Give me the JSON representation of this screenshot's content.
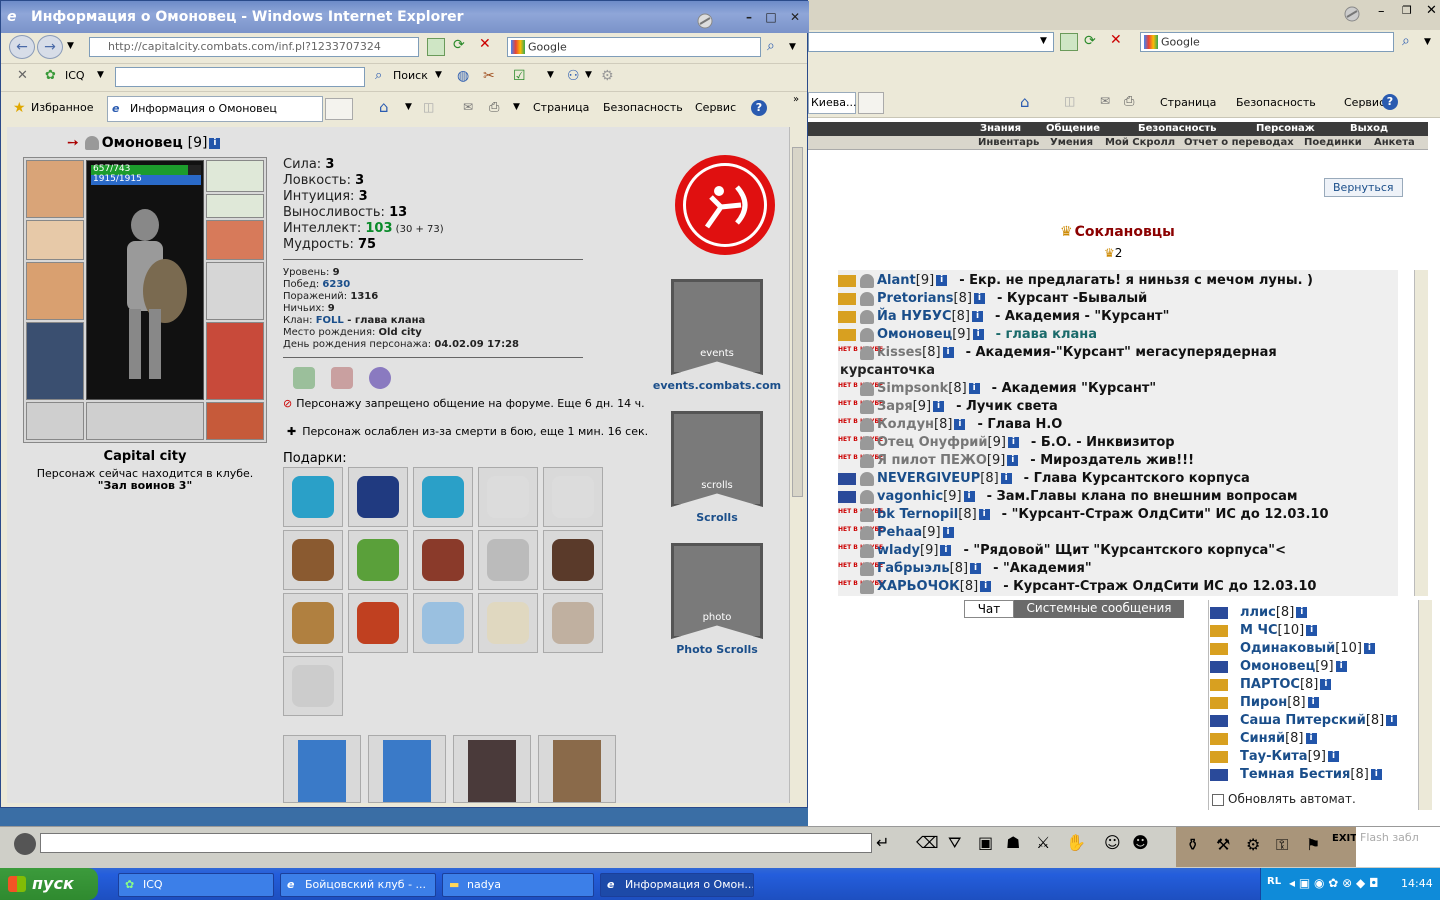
{
  "bg_window": {
    "search_placeholder": "Google",
    "tab_label": "Киева...",
    "toolbar": {
      "page": "Страница",
      "security": "Безопасность",
      "service": "Сервис"
    },
    "menu_top": [
      "Знания",
      "Общение",
      "Безопасность",
      "Персонаж",
      "Выход"
    ],
    "menu_sub": [
      "Инвентарь",
      "Умения",
      "Мой Скролл",
      "Отчет о переводах",
      "Поединки",
      "Анкета"
    ],
    "back_button": "Вернуться",
    "clan_title": "Соклановцы",
    "clan_count": "2",
    "members": [
      {
        "name": "Alant",
        "level": "[9]",
        "note": "- Екр. не предлагать! я ниньзя с мечом луны. )"
      },
      {
        "name": "Pretorians",
        "level": "[8]",
        "note": "- Курсант -Бывалый"
      },
      {
        "name": "Йа НУБУС",
        "level": "[8]",
        "note": "- Академия - \"Курсант\""
      },
      {
        "name": "Омоновец",
        "level": "[9]",
        "note": "- глава клана"
      },
      {
        "name": "kisses",
        "level": "[8]",
        "note": "- Академия-\"Курсант\" мегасуперядерная"
      },
      {
        "name": "курсанточка",
        "level": "",
        "note": ""
      },
      {
        "name": "Simpsonk",
        "level": "[8]",
        "note": "- Академия \"Курсант\""
      },
      {
        "name": "Заря",
        "level": "[9]",
        "note": "- Лучик света"
      },
      {
        "name": "Колдун",
        "level": "[8]",
        "note": "- Глава Н.О"
      },
      {
        "name": "Отец Онуфрий",
        "level": "[9]",
        "note": "- Б.О. - Инквизитор"
      },
      {
        "name": "Я пилот ПЕЖО",
        "level": "[9]",
        "note": "- Мироздатель жив!!!"
      },
      {
        "name": "NEVERGIVEUP",
        "level": "[8]",
        "note": "- Глава Курсантского корпуса"
      },
      {
        "name": "vagonhic",
        "level": "[9]",
        "note": "- Зам.Главы клана по внешним вопросам"
      },
      {
        "name": "bk Ternopil",
        "level": "[8]",
        "note": "- \"Курсант-Страж ОлдСити\" ИС до 12.03.10"
      },
      {
        "name": "Pehaa",
        "level": "[9]",
        "note": ""
      },
      {
        "name": "wlady",
        "level": "[9]",
        "note": "- \"Рядовой\" Щит \"Курсантского корпуса\"<"
      },
      {
        "name": "Габрыэль",
        "level": "[8]",
        "note": "- \"Академия\""
      },
      {
        "name": "ХАРЬОЧОК",
        "level": "[8]",
        "note": "- Курсант-Страж ОлдСити ИС до 12.03.10"
      }
    ],
    "offline_label": "НЕТ В КЛУБЕ",
    "chat_tabs": [
      "Чат",
      "Системные сообщения"
    ],
    "online": [
      {
        "name": "ллис",
        "level": "[8]"
      },
      {
        "name": "М ЧС",
        "level": "[10]"
      },
      {
        "name": "Одинаковый",
        "level": "[10]"
      },
      {
        "name": "Омоновец",
        "level": "[9]"
      },
      {
        "name": "ПАРТОС",
        "level": "[8]"
      },
      {
        "name": "Пирон",
        "level": "[8]"
      },
      {
        "name": "Саша Питерский",
        "level": "[8]"
      },
      {
        "name": "Синяй",
        "level": "[8]"
      },
      {
        "name": "Тау-Кита",
        "level": "[9]"
      },
      {
        "name": "Темная Бестия",
        "level": "[8]"
      }
    ],
    "auto_refresh": "Обновлять автомат.",
    "flash_label": "Flash забл"
  },
  "fg_window": {
    "title": "Информация о Омоновец - Windows Internet Explorer",
    "address": "http://capitalcity.combats.com/inf.pl?1233707324",
    "search_placeholder": "Google",
    "icq_label": "ICQ",
    "search_label": "Поиск",
    "favorites_label": "Избранное",
    "tab_label": "Информация о Омоновец",
    "toolbar": {
      "page": "Страница",
      "security": "Безопасность",
      "service": "Сервис"
    }
  },
  "character": {
    "name": "Омоновец",
    "level": "[9]",
    "hp": "657/743",
    "mana": "1915/1915",
    "hp_fraction": 0.884,
    "city": "Capital city",
    "location_line1": "Персонаж сейчас находится в клубе.",
    "location_line2": "\"Зал воинов 3\"",
    "stats": [
      {
        "label": "Сила:",
        "value": "3"
      },
      {
        "label": "Ловкость:",
        "value": "3"
      },
      {
        "label": "Интуиция:",
        "value": "3"
      },
      {
        "label": "Выносливость:",
        "value": "13"
      },
      {
        "label": "Интеллект:",
        "value": "103",
        "extra": "(30 + 73)"
      },
      {
        "label": "Мудрость:",
        "value": "75"
      }
    ],
    "info": [
      {
        "label": "Уровень:",
        "value": "9"
      },
      {
        "label": "Побед:",
        "value": "6230"
      },
      {
        "label": "Поражений:",
        "value": "1316"
      },
      {
        "label": "Ничьих:",
        "value": "9"
      },
      {
        "label": "Клан:",
        "value": "FOLL",
        "extra": "- глава клана"
      },
      {
        "label": "Место рождения:",
        "value": "Old city"
      },
      {
        "label": "День рождения персонажа:",
        "value": "04.02.09 17:28"
      }
    ],
    "ban_text": "Персонажу запрещено общение на форуме. Еще 6 дн. 14 ч.",
    "weak_text": "Персонаж ослаблен из-за смерти в бою, еще 1 мин. 16 сек.",
    "gifts_label": "Подарки:",
    "banners": [
      {
        "label": "events.combats.com",
        "inner": "events"
      },
      {
        "label": "Scrolls",
        "inner": "scrolls"
      },
      {
        "label": "Photo Scrolls",
        "inner": "photo"
      }
    ]
  },
  "taskbar": {
    "start": "пуск",
    "tasks": [
      "ICQ",
      "Бойцовский клуб - ...",
      "nadya",
      "Информация о Омон..."
    ],
    "time": "14:44",
    "lang": "RL"
  }
}
